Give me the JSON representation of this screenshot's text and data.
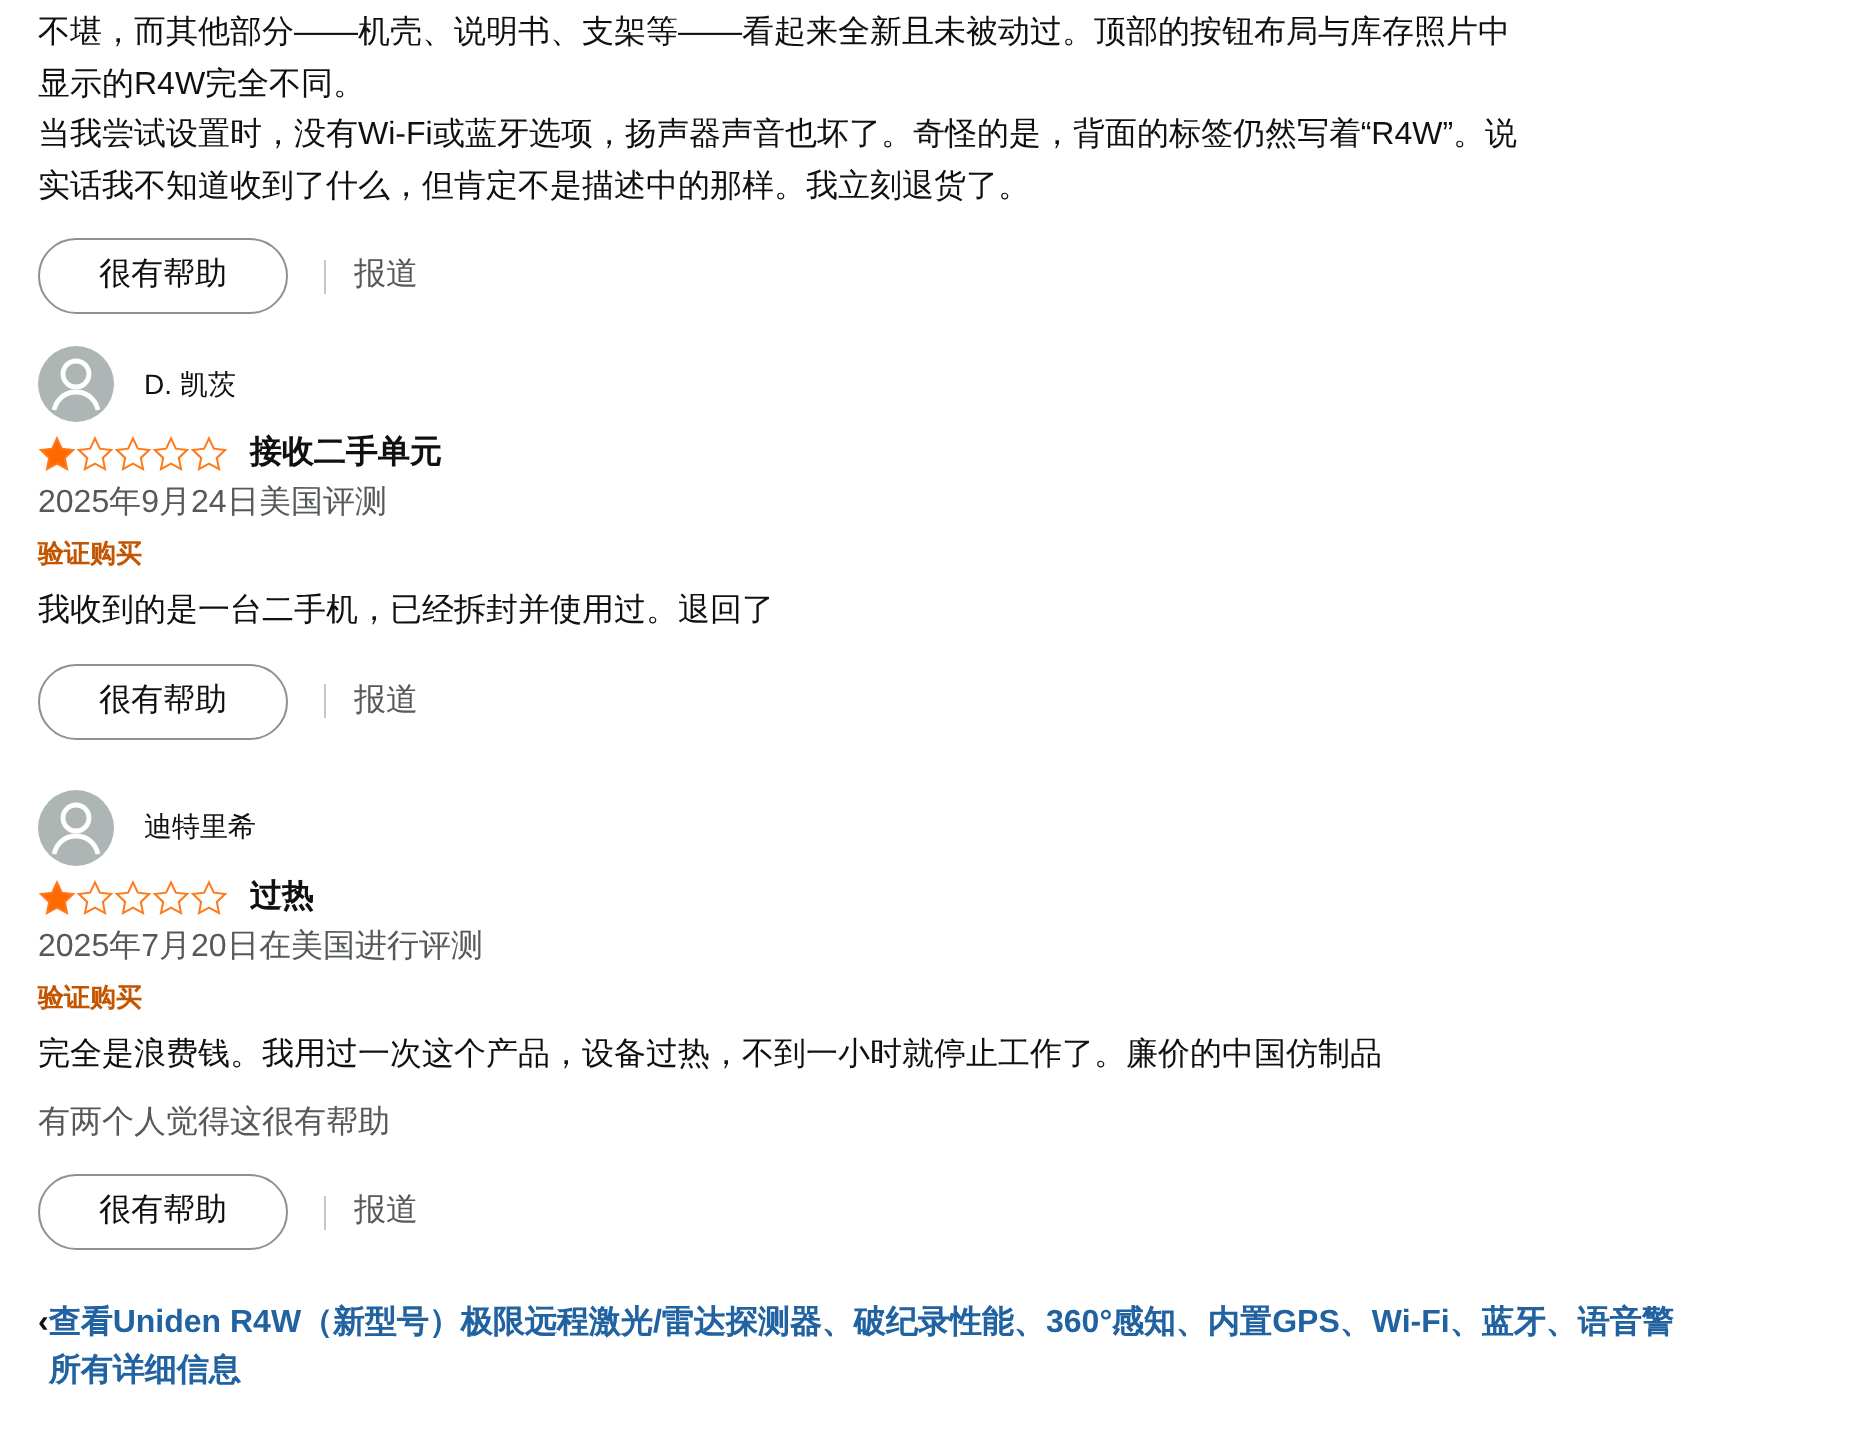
{
  "reviews": [
    {
      "body": [
        "不堪，而其他部分——机壳、说明书、支架等——看起来全新且未被动过。顶部的按钮布局与库存照片中显示的R4W完全不同。",
        "当我尝试设置时，没有Wi-Fi或蓝牙选项，扬声器声音也坏了。奇怪的是，背面的标签仍然写着“R4W”。说实话我不知道收到了什么，但肯定不是描述中的那样。我立刻退货了。"
      ],
      "helpful_button": "很有帮助",
      "report_link": "报道"
    },
    {
      "author": "D. 凯茨",
      "stars": 1,
      "title": "接收二手单元",
      "date": "2025年9月24日美国评测",
      "verified": "验证购买",
      "body": [
        "我收到的是一台二手机，已经拆封并使用过。退回了"
      ],
      "helpful_button": "很有帮助",
      "report_link": "报道"
    },
    {
      "author": "迪特里希",
      "stars": 1,
      "title": "过热",
      "date": "2025年7月20日在美国进行评测",
      "verified": "验证购买",
      "body": [
        "完全是浪费钱。我用过一次这个产品，设备过热，不到一小时就停止工作了。廉价的中国仿制品"
      ],
      "helpful_count": "有两个人觉得这很有帮助",
      "helpful_button": "很有帮助",
      "report_link": "报道"
    }
  ],
  "see_all_link": {
    "arrow": "‹",
    "lines": [
      "查看Uniden R4W（新型号）极限远程激光/雷达探测器、破纪录性能、360°感知、内置GPS、Wi-Fi、蓝牙、语音警",
      "所有详细信息"
    ]
  }
}
